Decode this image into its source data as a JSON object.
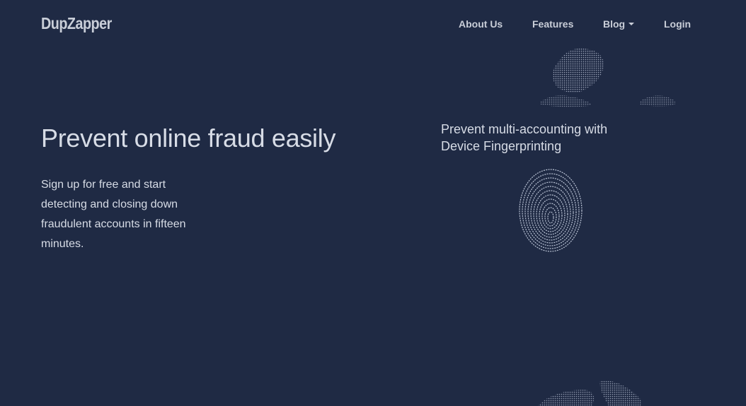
{
  "brand": {
    "name": "DupZapper"
  },
  "nav": {
    "about": "About Us",
    "features": "Features",
    "blog": "Blog",
    "login": "Login"
  },
  "hero": {
    "title": "Prevent online fraud easily",
    "text": "Sign up for free and start detecting and closing down fraudulent accounts in fifteen minutes."
  },
  "feature": {
    "caption": "Prevent multi-accounting with Device Fingerprinting",
    "icon": "fingerprint-icon"
  },
  "colors": {
    "background": "#1f2a44",
    "text": "#d7dce6",
    "accent": "#c9ced8"
  }
}
